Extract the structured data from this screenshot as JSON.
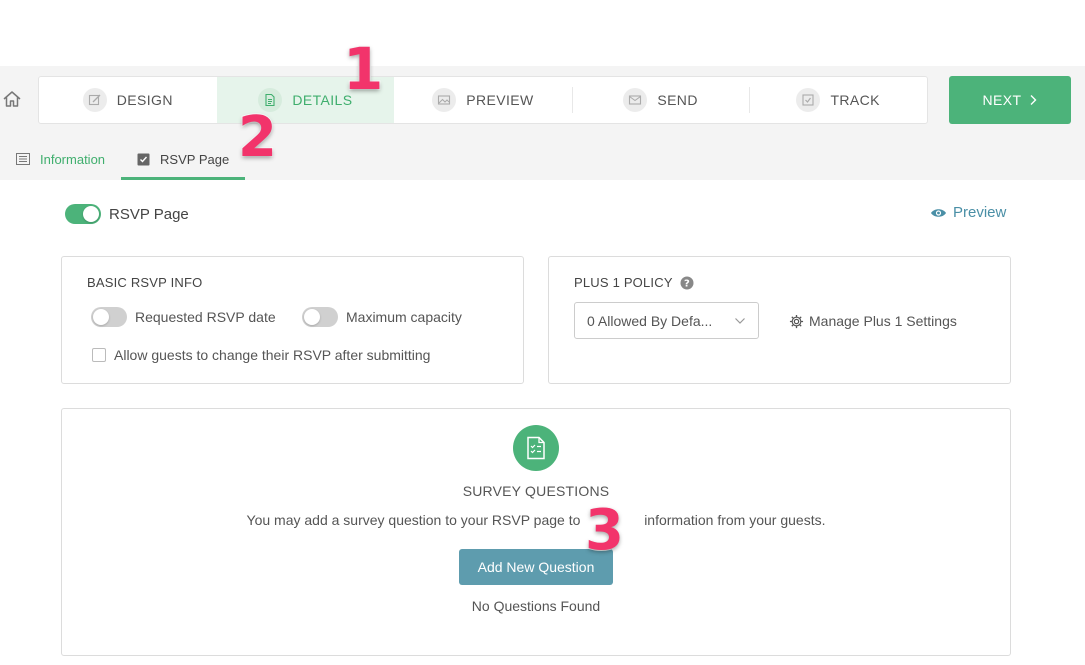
{
  "steps": [
    {
      "label": "DESIGN",
      "icon": "pencil-icon"
    },
    {
      "label": "DETAILS",
      "icon": "document-icon",
      "active": true
    },
    {
      "label": "PREVIEW",
      "icon": "image-icon"
    },
    {
      "label": "SEND",
      "icon": "envelope-icon"
    },
    {
      "label": "TRACK",
      "icon": "check-square-icon"
    }
  ],
  "next_button": {
    "label": "NEXT",
    "icon": "chevron-right-icon"
  },
  "subtabs": {
    "information": "Information",
    "rsvp": "RSVP Page"
  },
  "rsvp_toggle": {
    "label": "RSVP Page",
    "on": true
  },
  "preview_link": "Preview",
  "basic_info": {
    "title": "BASIC RSVP INFO",
    "requested_date": "Requested RSVP date",
    "max_capacity": "Maximum capacity",
    "allow_change": "Allow guests to change their RSVP after submitting"
  },
  "plus_policy": {
    "title": "PLUS 1 POLICY",
    "select_value": "0 Allowed By Defa...",
    "manage_link": "Manage Plus 1 Settings"
  },
  "survey": {
    "title": "SURVEY QUESTIONS",
    "description": "You may add a survey question to your RSVP page to      information from your guests.",
    "desc_before": "You may add a survey question to your RSVP page to",
    "desc_after": "information from your guests.",
    "add_button": "Add New Question",
    "empty": "No Questions Found"
  },
  "badges": [
    "1",
    "2",
    "3"
  ],
  "colors": {
    "accent_green": "#4cb37a",
    "link_blue": "#4a8fa6",
    "badge_pink": "#f2346b",
    "button_blue": "#5e9cae"
  }
}
